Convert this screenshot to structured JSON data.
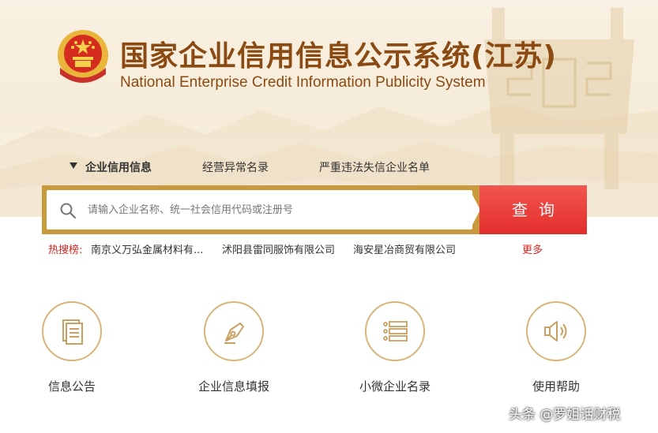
{
  "header": {
    "title_zh": "国家企业信用信息公示系统(江苏)",
    "title_en": "National Enterprise Credit Information Publicity System"
  },
  "tabs": [
    {
      "label": "企业信用信息",
      "active": true
    },
    {
      "label": "经营异常名录",
      "active": false
    },
    {
      "label": "严重违法失信企业名单",
      "active": false
    }
  ],
  "search": {
    "placeholder": "请输入企业名称、统一社会信用代码或注册号",
    "button_label": "查询"
  },
  "hot_search": {
    "label": "热搜榜:",
    "items": [
      "南京义万弘金属材料有...",
      "沭阳县雷同服饰有限公司",
      "海安星冶商贸有限公司"
    ],
    "more_label": "更多"
  },
  "features": [
    {
      "label": "信息公告",
      "icon": "document-icon"
    },
    {
      "label": "企业信息填报",
      "icon": "pen-nib-icon"
    },
    {
      "label": "小微企业名录",
      "icon": "list-icon"
    },
    {
      "label": "使用帮助",
      "icon": "speaker-icon"
    }
  ],
  "watermark": "头条 @罗姐话财税",
  "colors": {
    "brand_brown": "#8a4a12",
    "gold_border": "#c99a3c",
    "search_red": "#e83a36",
    "hot_red": "#d7261f",
    "icon_gold": "#d7b47a"
  }
}
